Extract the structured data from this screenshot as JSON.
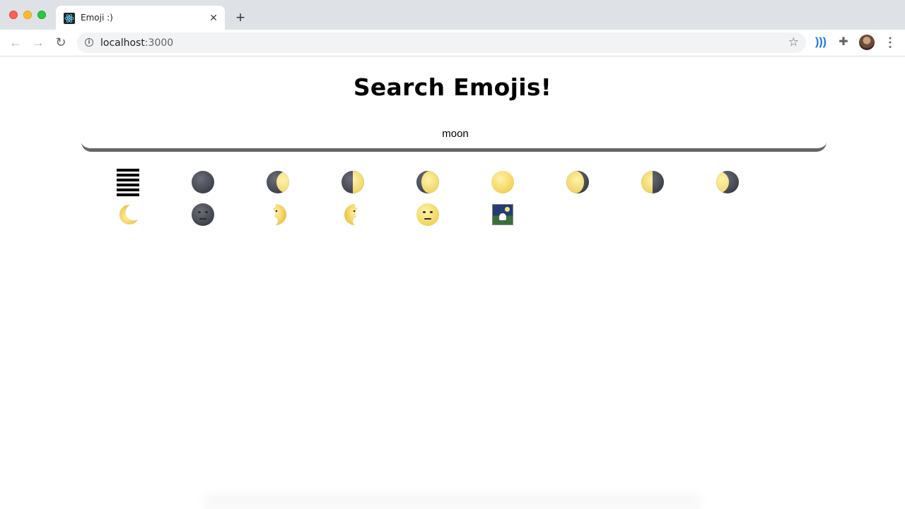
{
  "browser": {
    "tab_title": "Emoji :)",
    "url_host": "localhost",
    "url_port": ":3000",
    "accent": "#1a73e8"
  },
  "page": {
    "title": "Search Emojis!",
    "search_value": "moon",
    "rule_color": "#666666"
  },
  "emojis": [
    {
      "name": "hexagram-for-the-creative-heaven",
      "kind": "hexagram"
    },
    {
      "name": "new-moon",
      "kind": "moon"
    },
    {
      "name": "waxing-crescent-moon",
      "kind": "moon"
    },
    {
      "name": "first-quarter-moon",
      "kind": "moon"
    },
    {
      "name": "waxing-gibbous-moon",
      "kind": "moon"
    },
    {
      "name": "full-moon",
      "kind": "moon"
    },
    {
      "name": "waning-gibbous-moon",
      "kind": "moon"
    },
    {
      "name": "last-quarter-moon",
      "kind": "moon"
    },
    {
      "name": "waning-crescent-moon",
      "kind": "moon"
    },
    {
      "name": "crescent-moon",
      "kind": "moon"
    },
    {
      "name": "new-moon-face",
      "kind": "face"
    },
    {
      "name": "first-quarter-moon-face",
      "kind": "face"
    },
    {
      "name": "last-quarter-moon-face",
      "kind": "face"
    },
    {
      "name": "full-moon-face",
      "kind": "face"
    },
    {
      "name": "moon-viewing-ceremony",
      "kind": "picture"
    }
  ]
}
